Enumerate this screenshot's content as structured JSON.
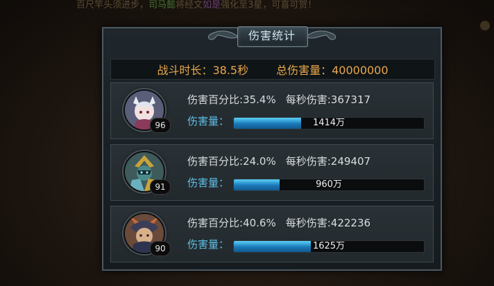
{
  "background": {
    "ticker_parts": [
      "百尺竿头须进步，",
      "司马懿",
      "将经文",
      "如是",
      "强化至3星，可喜可贺！"
    ]
  },
  "panel": {
    "title": "伤害统计",
    "battle_time": "战斗时长：38.5秒",
    "total_damage": "总伤害量：40000000"
  },
  "rows": [
    {
      "level": "96",
      "pct_label": "伤害百分比",
      "pct": ":35.4%",
      "dps_label": "每秒伤害",
      "dps": ":367317",
      "dmg_label": "伤害量：",
      "dmg_value": "1414万",
      "fill_fraction": 0.354
    },
    {
      "level": "91",
      "pct_label": "伤害百分比",
      "pct": ":24.0%",
      "dps_label": "每秒伤害",
      "dps": ":249407",
      "dmg_label": "伤害量：",
      "dmg_value": "960万",
      "fill_fraction": 0.24
    },
    {
      "level": "90",
      "pct_label": "伤害百分比",
      "pct": ":40.6%",
      "dps_label": "每秒伤害",
      "dps": ":422236",
      "dmg_label": "伤害量：",
      "dmg_value": "1625万",
      "fill_fraction": 0.406
    }
  ],
  "colors": {
    "accent_gold": "#e8a84a",
    "bar_blue": "#1a78b8",
    "label_blue": "#5fc0e8"
  }
}
